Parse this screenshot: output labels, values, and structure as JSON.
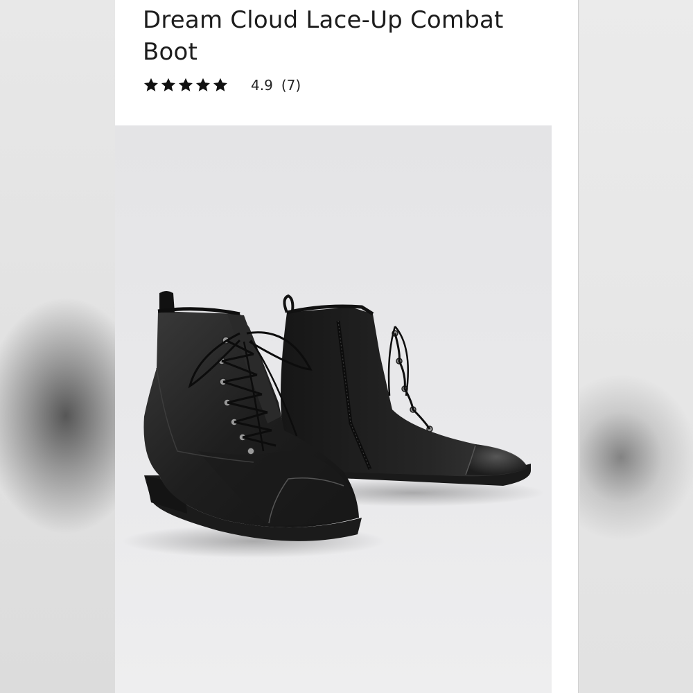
{
  "product": {
    "title": "Dream Cloud Lace-Up Combat Boot",
    "rating": {
      "stars": 5,
      "value": "4.9",
      "count": "(7)"
    },
    "image": {
      "icon": "product-photo-black-lace-up-combat-boots"
    }
  },
  "colors": {
    "background": "#ffffff",
    "text": "#1c1c1c",
    "star": "#111111",
    "photo_backdrop": "#e6e6e8"
  }
}
